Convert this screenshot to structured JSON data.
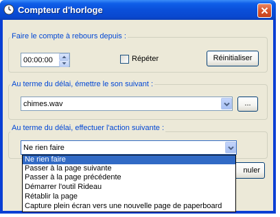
{
  "window": {
    "title": "Compteur d'horloge",
    "accent": "#0a4fd9",
    "close_icon": "close-icon"
  },
  "countdown_group": {
    "legend": "Faire le compte à rebours depuis :",
    "time_value": "00:00:00",
    "repeat_label": "Répéter",
    "repeat_checked": false,
    "reset_label": "Réinitialiser"
  },
  "sound_group": {
    "legend": "Au terme du délai, émettre le son suivant :",
    "sound_value": "chimes.wav",
    "browse_label": "..."
  },
  "action_group": {
    "legend": "Au terme du délai, effectuer l'action suivante :",
    "action_value": "Ne rien faire",
    "options": [
      "Ne rien faire",
      "Passer à la page suivante",
      "Passer à la page précédente",
      "Démarrer l'outil Rideau",
      "Rétablir la page",
      "Capture plein écran vers une nouvelle page de paperboard"
    ],
    "selected_index": 0
  },
  "footer": {
    "cancel_label_partial": "nuler"
  }
}
